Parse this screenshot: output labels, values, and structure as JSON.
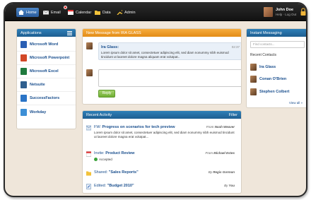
{
  "topbar": {
    "nav": [
      {
        "label": "Home",
        "icon": "home-icon",
        "active": true
      },
      {
        "label": "Email",
        "icon": "email-icon",
        "active": false
      },
      {
        "label": "Calendar",
        "icon": "calendar-icon",
        "active": false
      },
      {
        "label": "Data",
        "icon": "folder-icon",
        "active": false
      },
      {
        "label": "Admin",
        "icon": "wrench-icon",
        "active": false
      }
    ],
    "user_name": "John Doe",
    "user_links": "Help · Log Out"
  },
  "applications": {
    "title": "Applications",
    "items": [
      {
        "label": "Microsoft Word",
        "icon": "word-icon",
        "color": "#2b5fb3"
      },
      {
        "label": "Microsoft Powerpoint",
        "icon": "powerpoint-icon",
        "color": "#d24726"
      },
      {
        "label": "Microsoft Excel",
        "icon": "excel-icon",
        "color": "#1f7a3d"
      },
      {
        "label": "Netsuite",
        "icon": "netsuite-icon",
        "color": "#2f5f8e"
      },
      {
        "label": "SuccessFactors",
        "icon": "successfactors-icon",
        "color": "#2b74c6"
      },
      {
        "label": "Workday",
        "icon": "workday-icon",
        "color": "#3d8fd6"
      }
    ]
  },
  "new_message": {
    "title": "New Message from IRA GLASS",
    "sender": "Ira Glass:",
    "time": "02:37",
    "text": "Lorem ipsum dolor sit amet, consectetuer adipiscing elit, sed diam nonummy nibh euismod tincidunt ut laoreet dolore magna aliquam erat volutpat..",
    "reply_label": "Reply"
  },
  "recent_activity": {
    "title": "Recent Activity",
    "filter_label": "Filter",
    "items": [
      {
        "prefix": "FW: ",
        "title": "Progress on scenarios for tech preview",
        "by_prefix": "From ",
        "by": "Noah Weaver",
        "body": "Lorem ipsum dolor sit amet, consectetuer adipiscing elit, sed diam nonummy nibh euismod tincidunt ut laoreet dolore magna erat volutpat..."
      },
      {
        "prefix": "Invite: ",
        "title": "Product Review",
        "by_prefix": "From ",
        "by": "Michael Estes",
        "status": "Accepted"
      },
      {
        "prefix": "Shared: ",
        "title": "\"Sales Reports\"",
        "by_prefix": "By ",
        "by": "Regis Gorman"
      },
      {
        "prefix": "Edited: ",
        "title": "\"Budget 2010\"",
        "by_prefix": "By ",
        "by": "You"
      }
    ]
  },
  "instant_messaging": {
    "title": "Instant Messaging",
    "search_placeholder": "Find contacts...",
    "recent_contacts_label": "Recent Contacts",
    "contacts": [
      "Ira Glass",
      "Conan O'Brien",
      "Stephen Colbert"
    ],
    "view_all": "View all »"
  },
  "colors": {
    "accent_blue": "#2f7fb8",
    "accent_orange": "#f6ac3d",
    "link": "#1a4f8e"
  }
}
